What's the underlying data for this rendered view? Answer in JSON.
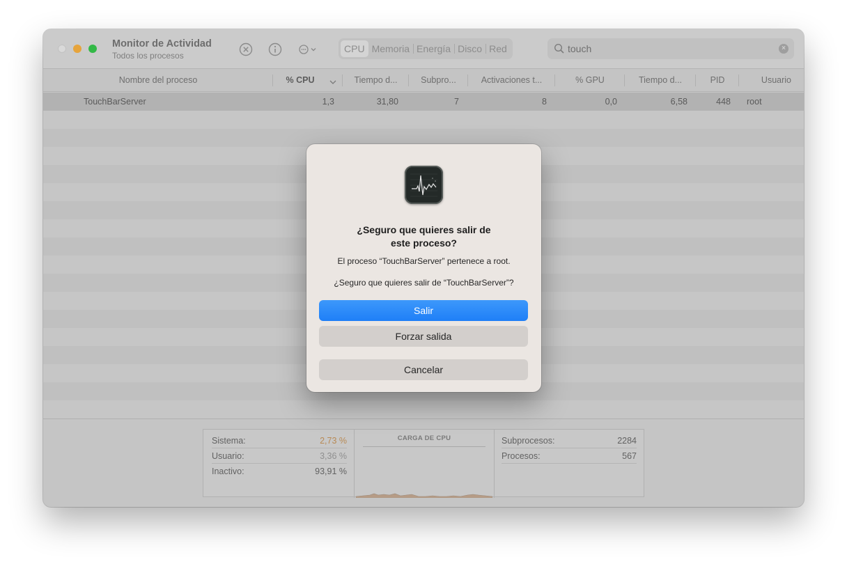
{
  "window": {
    "title": "Monitor de Actividad",
    "subtitle": "Todos los procesos"
  },
  "toolbar": {
    "icons": [
      "stop-process-icon",
      "info-icon",
      "more-options-icon"
    ],
    "tabs": [
      {
        "label": "CPU",
        "active": true
      },
      {
        "label": "Memoria",
        "active": false
      },
      {
        "label": "Energía",
        "active": false
      },
      {
        "label": "Disco",
        "active": false
      },
      {
        "label": "Red",
        "active": false
      }
    ],
    "search": {
      "value": "touch",
      "icon": "search-icon",
      "clear_icon": "clear-search-icon"
    }
  },
  "table": {
    "columns": [
      "Nombre del proceso",
      "% CPU",
      "Tiempo d...",
      "Subpro...",
      "Activaciones t...",
      "% GPU",
      "Tiempo d...",
      "PID",
      "Usuario"
    ],
    "sort_column": "% CPU",
    "rows": [
      {
        "name": "TouchBarServer",
        "cpu": "1,3",
        "cpu_time": "31,80",
        "threads": "7",
        "wakeups": "8",
        "gpu": "0,0",
        "gpu_time": "6,58",
        "pid": "448",
        "user": "root"
      }
    ]
  },
  "stats": {
    "left": [
      {
        "label": "Sistema:",
        "value": "2,73 %"
      },
      {
        "label": "Usuario:",
        "value": "3,36 %"
      },
      {
        "label": "Inactivo:",
        "value": "93,91 %"
      }
    ],
    "graph_title": "CARGA DE CPU",
    "right": [
      {
        "label": "Subprocesos:",
        "value": "2284"
      },
      {
        "label": "Procesos:",
        "value": "567"
      }
    ]
  },
  "dialog": {
    "icon": "activity-monitor-icon",
    "title_line1": "¿Seguro que quieres salir de",
    "title_line2": "este proceso?",
    "message1": "El proceso “TouchBarServer” pertenece a root.",
    "message2": "¿Seguro que quieres salir de “TouchBarServer”?",
    "primary_label": "Salir",
    "force_label": "Forzar salida",
    "cancel_label": "Cancelar"
  },
  "colors": {
    "accent": "#1f7ff7",
    "close_light": "#d9d9d9",
    "minimize": "#e6a43c",
    "maximize": "#33b947",
    "system_stat": "#b88a55"
  }
}
